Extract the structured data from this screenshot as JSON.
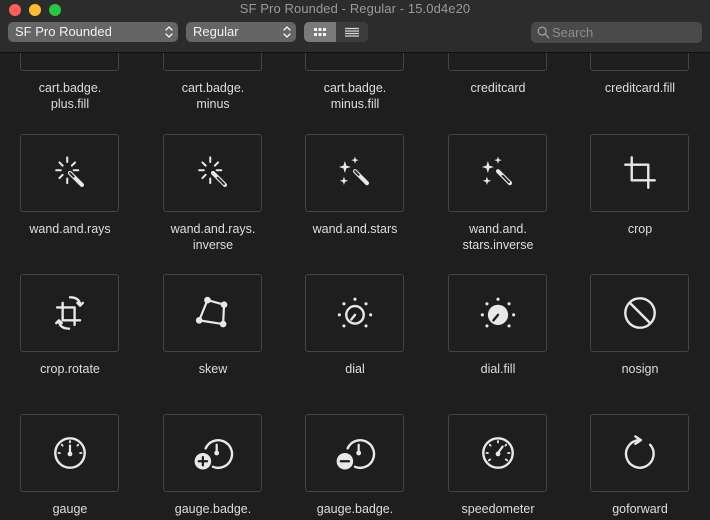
{
  "window": {
    "title": "SF Pro Rounded - Regular - 15.0d4e20"
  },
  "toolbar": {
    "font_family_select": "SF Pro Rounded",
    "font_weight_select": "Regular",
    "view_mode": "grid",
    "search_placeholder": "Search"
  },
  "symbols": {
    "row1": [
      {
        "label": "cart.badge.\nplus.fill"
      },
      {
        "label": "cart.badge.\nminus"
      },
      {
        "label": "cart.badge.\nminus.fill"
      },
      {
        "label": "creditcard"
      },
      {
        "label": "creditcard.fill"
      }
    ],
    "row2": [
      {
        "label": "wand.and.rays",
        "icon": "wand-and-rays-icon"
      },
      {
        "label": "wand.and.rays.\ninverse",
        "icon": "wand-and-rays-inverse-icon"
      },
      {
        "label": "wand.and.stars",
        "icon": "wand-and-stars-icon"
      },
      {
        "label": "wand.and.\nstars.inverse",
        "icon": "wand-and-stars-inverse-icon"
      },
      {
        "label": "crop",
        "icon": "crop-icon"
      }
    ],
    "row3": [
      {
        "label": "crop.rotate",
        "icon": "crop-rotate-icon"
      },
      {
        "label": "skew",
        "icon": "skew-icon"
      },
      {
        "label": "dial",
        "icon": "dial-icon"
      },
      {
        "label": "dial.fill",
        "icon": "dial-fill-icon"
      },
      {
        "label": "nosign",
        "icon": "nosign-icon"
      }
    ],
    "row4": [
      {
        "label": "gauge",
        "icon": "gauge-icon"
      },
      {
        "label": "gauge.badge.",
        "icon": "gauge-badge-plus-icon"
      },
      {
        "label": "gauge.badge.",
        "icon": "gauge-badge-minus-icon"
      },
      {
        "label": "speedometer",
        "icon": "speedometer-icon"
      },
      {
        "label": "goforward",
        "icon": "goforward-icon"
      }
    ]
  }
}
